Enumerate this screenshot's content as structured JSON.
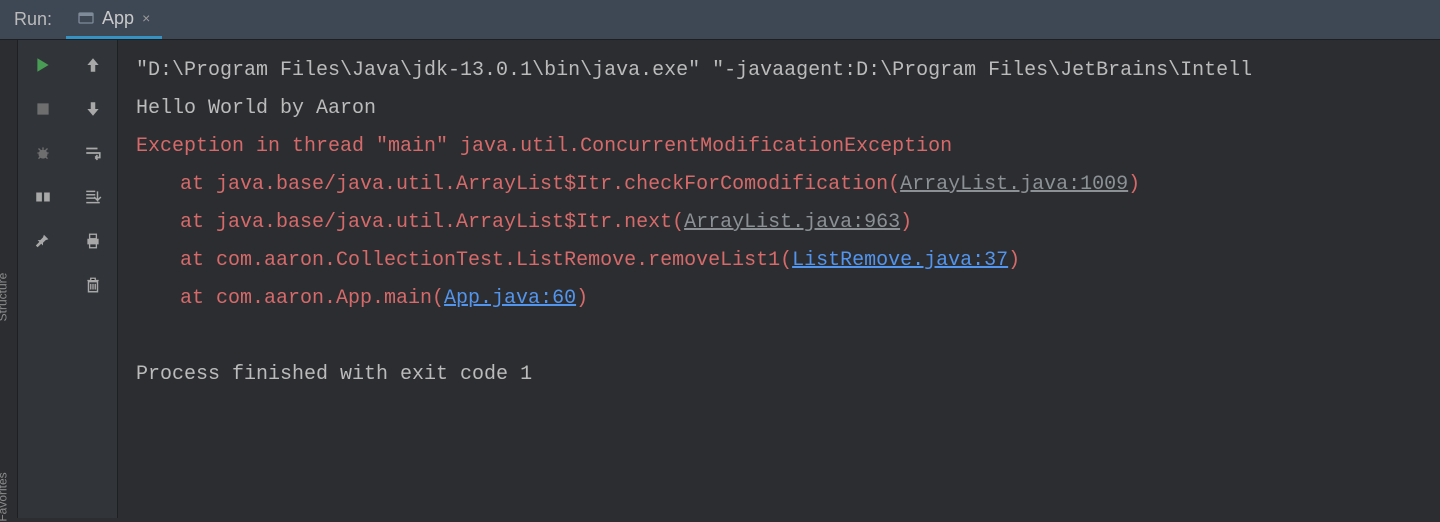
{
  "topbar": {
    "run_label": "Run:",
    "tab": {
      "label": "App",
      "close": "×"
    }
  },
  "sidebar_texts": {
    "structure": "Structure",
    "favorites": "Favorites"
  },
  "toolbar_a": {
    "run": "run-icon",
    "stop": "stop-icon",
    "bug": "bug-icon",
    "layout": "layout-icon",
    "pin": "pin-icon"
  },
  "toolbar_b": {
    "up": "up-arrow-icon",
    "down": "down-arrow-icon",
    "wrap": "soft-wrap-icon",
    "scroll": "scroll-to-end-icon",
    "print": "print-icon",
    "delete": "trash-icon"
  },
  "console": {
    "line1": "\"D:\\Program Files\\Java\\jdk-13.0.1\\bin\\java.exe\" \"-javaagent:D:\\Program Files\\JetBrains\\Intell",
    "line2": "Hello World by Aaron",
    "line3": "Exception in thread \"main\" java.util.ConcurrentModificationException",
    "line4_pre": "at java.base/java.util.ArrayList$Itr.checkForComodification(",
    "line4_link": "ArrayList.java:1009",
    "line4_post": ")",
    "line5_pre": "at java.base/java.util.ArrayList$Itr.next(",
    "line5_link": "ArrayList.java:963",
    "line5_post": ")",
    "line6_pre": "at com.aaron.CollectionTest.ListRemove.removeList1(",
    "line6_link": "ListRemove.java:37",
    "line6_post": ")",
    "line7_pre": "at com.aaron.App.main(",
    "line7_link": "App.java:60",
    "line7_post": ")",
    "line8": "Process finished with exit code 1"
  }
}
